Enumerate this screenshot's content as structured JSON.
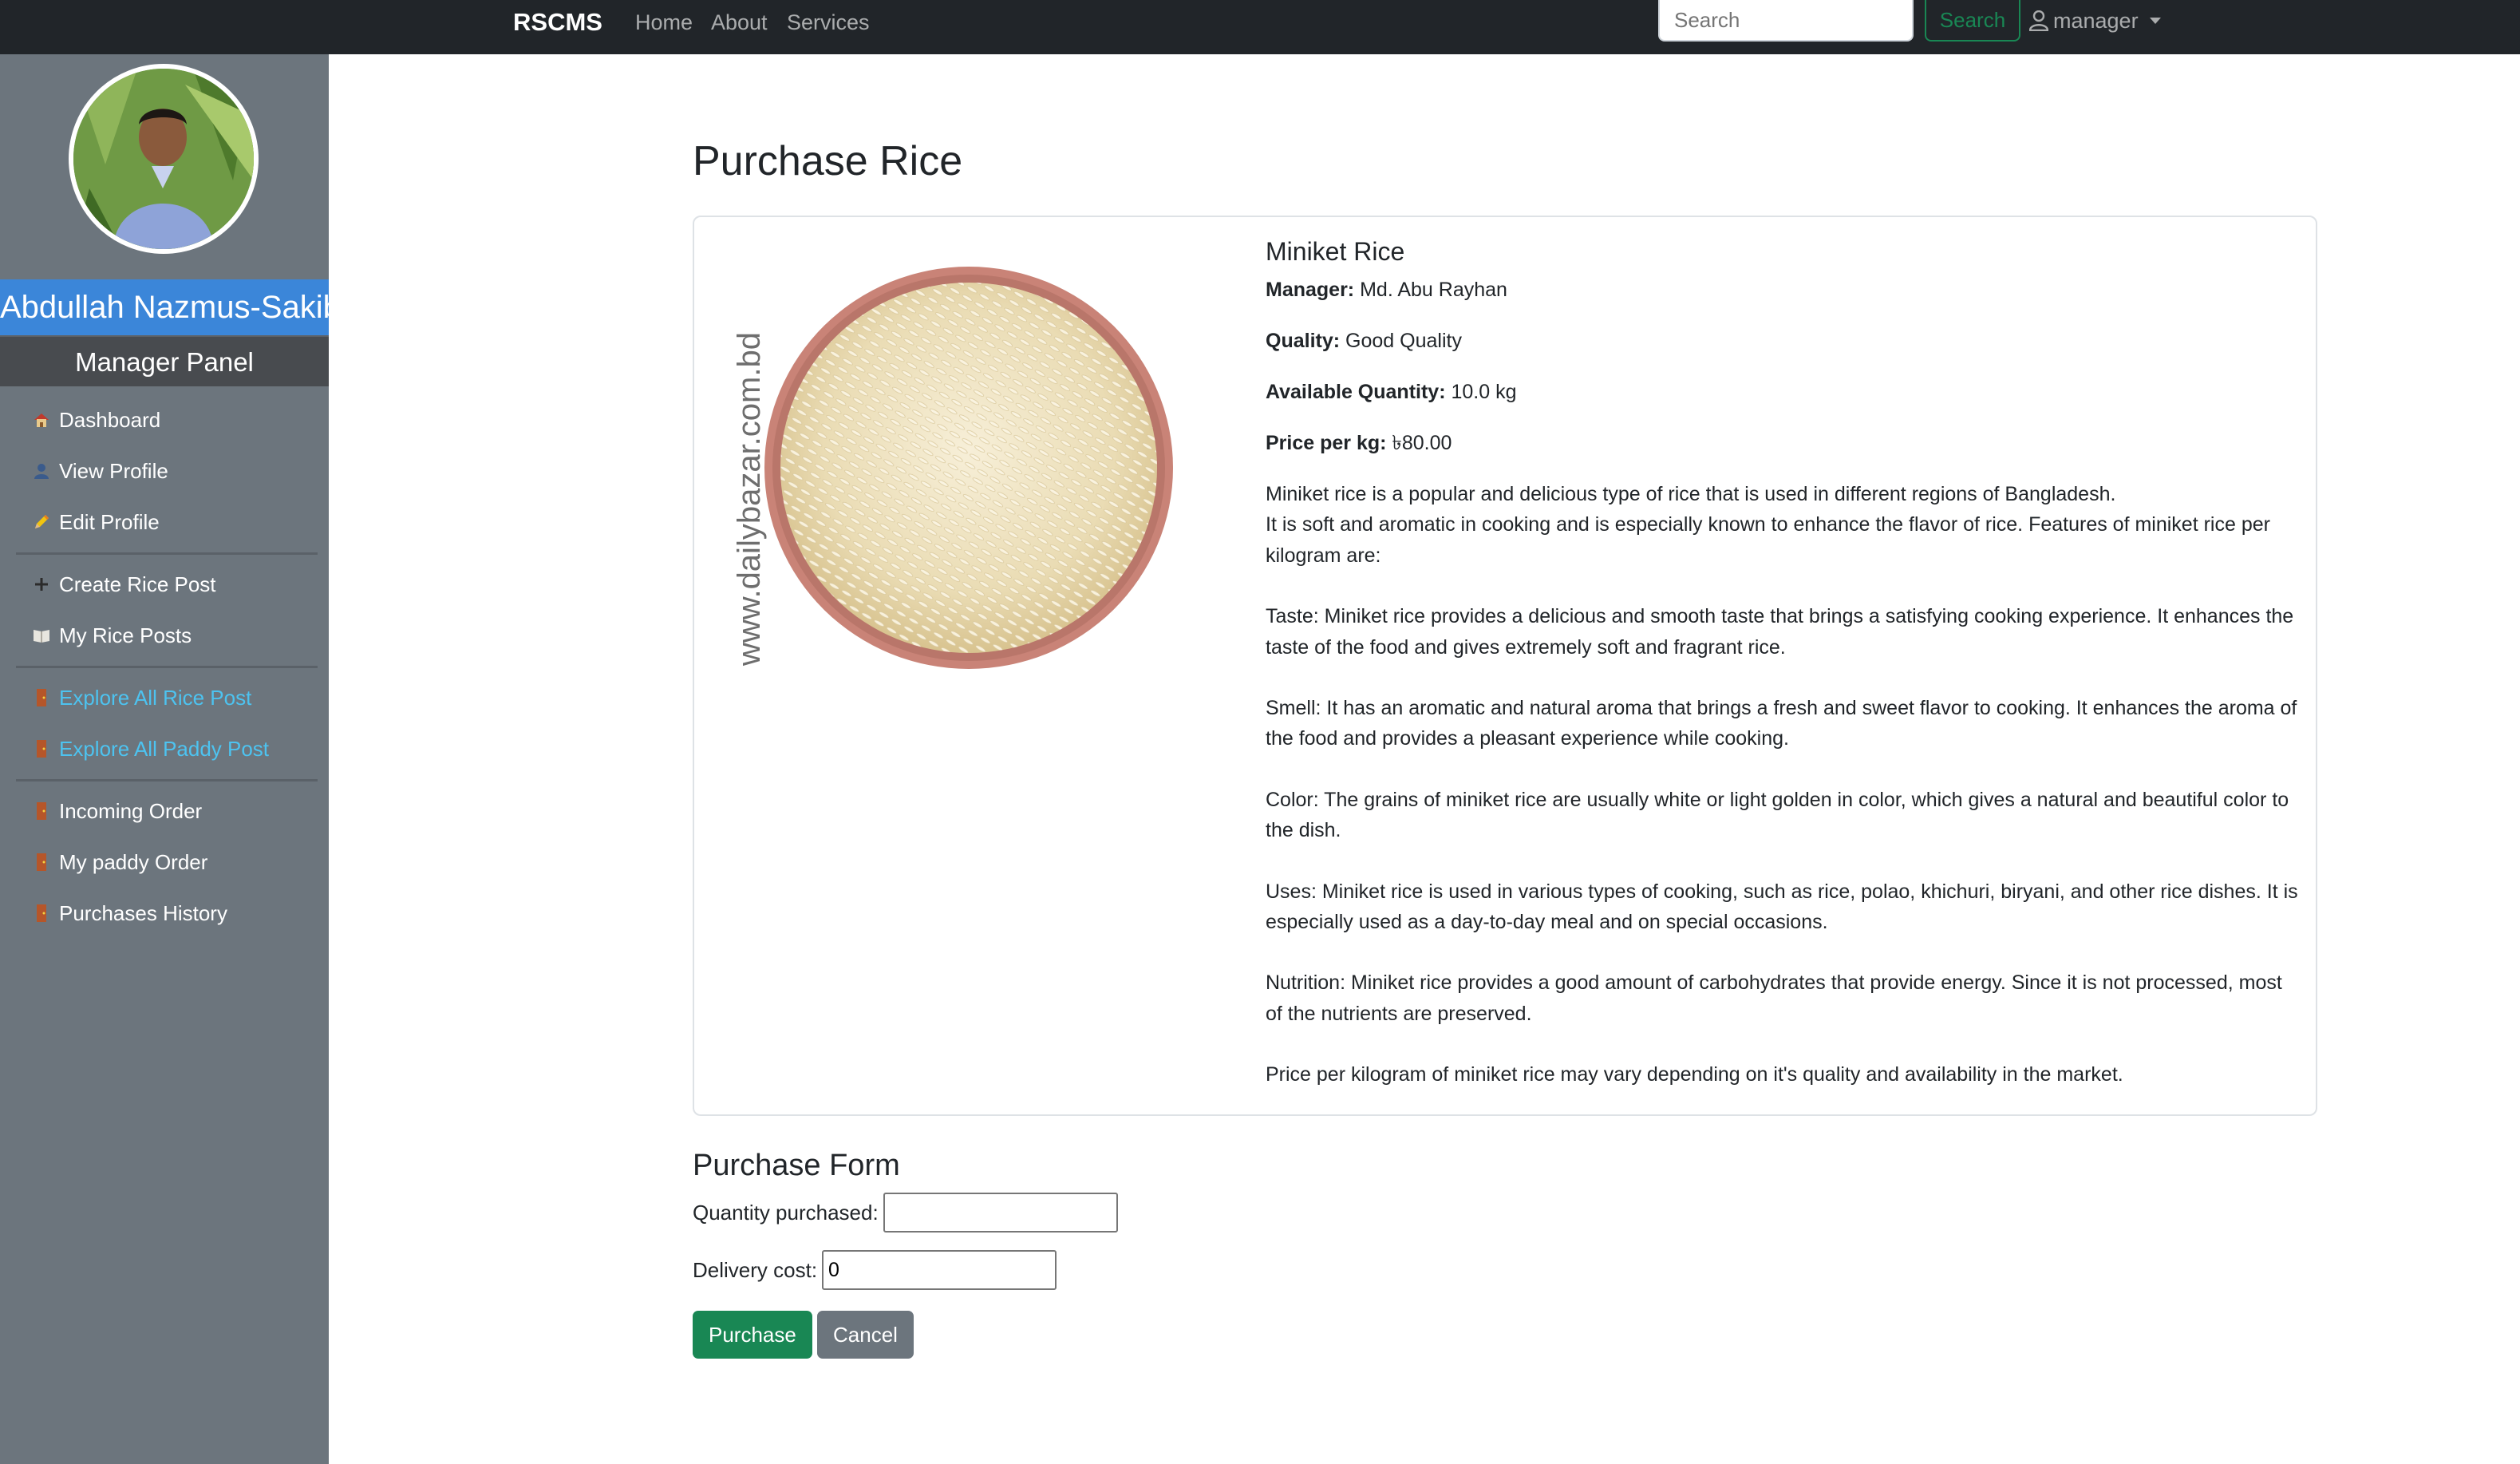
{
  "navbar": {
    "brand": "RSCMS",
    "links": [
      "Home",
      "About",
      "Services"
    ],
    "search_placeholder": "Search",
    "search_button": "Search",
    "user": "manager"
  },
  "sidebar": {
    "user_name": "Abdullah Nazmus-Sakib",
    "panel_title": "Manager Panel",
    "items": [
      {
        "label": "Dashboard",
        "icon": "house-icon"
      },
      {
        "label": "View Profile",
        "icon": "person-icon"
      },
      {
        "label": "Edit Profile",
        "icon": "pencil-icon"
      },
      {
        "label": "Create Rice Post",
        "icon": "plus-icon"
      },
      {
        "label": "My Rice Posts",
        "icon": "book-icon"
      },
      {
        "label": "Explore All Rice Post",
        "icon": "door-icon"
      },
      {
        "label": "Explore All Paddy Post",
        "icon": "door-icon"
      },
      {
        "label": "Incoming Order",
        "icon": "door-icon"
      },
      {
        "label": "My paddy Order",
        "icon": "door-icon"
      },
      {
        "label": "Purchases History",
        "icon": "door-icon"
      }
    ]
  },
  "main": {
    "title": "Purchase Rice",
    "product": {
      "name": "Miniket Rice",
      "image_watermark": "www.dailybazar.com.bd",
      "manager_label": "Manager:",
      "manager": "Md. Abu Rayhan",
      "quality_label": "Quality:",
      "quality": "Good Quality",
      "quantity_label": "Available Quantity:",
      "quantity": "10.0 kg",
      "price_label": "Price per kg:",
      "price": "৳80.00",
      "description": [
        "Miniket rice is a popular and delicious type of rice that is used in different regions of Bangladesh.",
        "It is soft and aromatic in cooking and is especially known to enhance the flavor of rice. Features of miniket rice per kilogram are:",
        "",
        "Taste: Miniket rice provides a delicious and smooth taste that brings a satisfying cooking experience. It enhances the taste of the food and gives extremely soft and fragrant rice.",
        "",
        "Smell: It has an aromatic and natural aroma that brings a fresh and sweet flavor to cooking. It enhances the aroma of the food and provides a pleasant experience while cooking.",
        "",
        "Color: The grains of miniket rice are usually white or light golden in color, which gives a natural and beautiful color to the dish.",
        "",
        "Uses: Miniket rice is used in various types of cooking, such as rice, polao, khichuri, biryani, and other rice dishes. It is especially used as a day-to-day meal and on special occasions.",
        "",
        "Nutrition: Miniket rice provides a good amount of carbohydrates that provide energy. Since it is not processed, most of the nutrients are preserved.",
        "",
        "Price per kilogram of miniket rice may vary depending on it's quality and availability in the market."
      ]
    },
    "form": {
      "title": "Purchase Form",
      "quantity_label": "Quantity purchased:",
      "quantity_value": "",
      "delivery_label": "Delivery cost:",
      "delivery_value": "0",
      "purchase_button": "Purchase",
      "cancel_button": "Cancel"
    }
  },
  "colors": {
    "navbar_bg": "#212529",
    "sidebar_bg": "#6c757d",
    "name_bar": "#3b86d9",
    "link": "#4dc3f0",
    "success": "#198754",
    "secondary": "#6c757d"
  }
}
